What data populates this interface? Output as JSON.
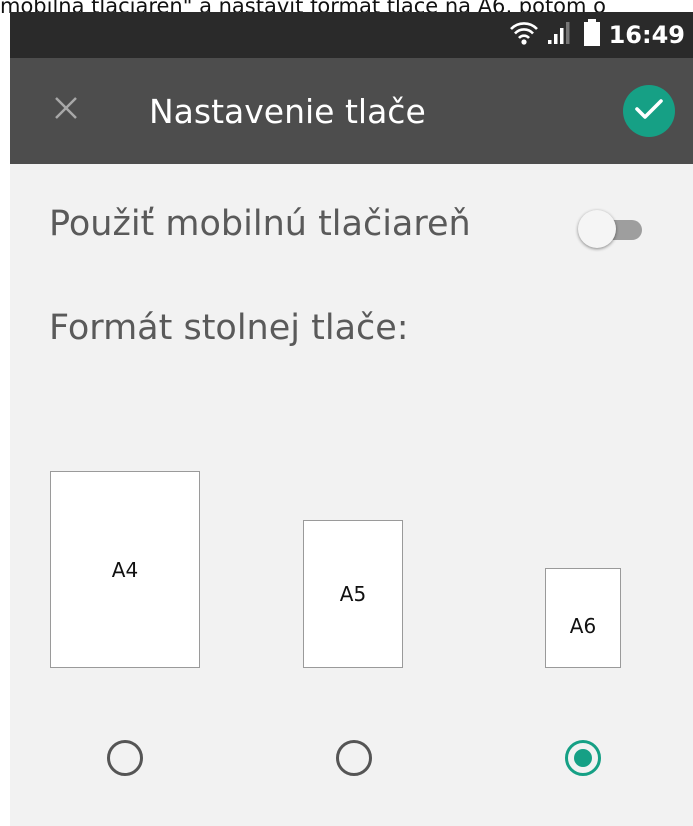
{
  "caption": "mobilná tlačiareň\" a nastaviť formát tlače na A6, potom o",
  "status_bar": {
    "time": "16:49",
    "icons": [
      "wifi-icon",
      "signal-icon",
      "battery-icon"
    ]
  },
  "app_bar": {
    "title": "Nastavenie tlače",
    "close_icon": "close-icon",
    "confirm_icon": "check-icon"
  },
  "mobile_printer": {
    "label": "Použiť mobilnú tlačiareň",
    "enabled": false
  },
  "format": {
    "label": "Formát stolnej tlače:",
    "options": [
      {
        "label": "A4",
        "selected": false
      },
      {
        "label": "A5",
        "selected": false
      },
      {
        "label": "A6",
        "selected": true
      }
    ]
  },
  "colors": {
    "accent": "#16a085",
    "app_bar": "#4d4d4d",
    "status_bar": "#2a2a2a",
    "background": "#f2f2f2"
  }
}
